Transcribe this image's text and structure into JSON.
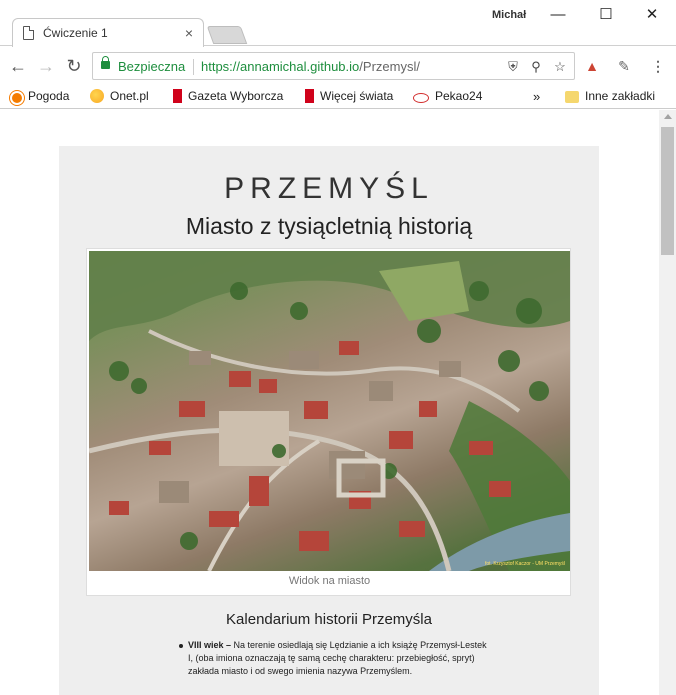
{
  "window": {
    "tab_title": "Ćwiczenie 1",
    "profile_name": "Michał",
    "minimize_icon": "minimize-icon",
    "maximize_icon": "maximize-icon",
    "close_icon": "close-icon"
  },
  "toolbar": {
    "secure_label": "Bezpieczna",
    "url_base": "https://annamichal.github.io",
    "url_path": "/Przemysl/"
  },
  "bookmarks": {
    "items": [
      {
        "label": "Pogoda",
        "icon": "sun-icon"
      },
      {
        "label": "Onet.pl",
        "icon": "onet-icon"
      },
      {
        "label": "Gazeta Wyborcza",
        "icon": "gw-icon"
      },
      {
        "label": "Więcej świata",
        "icon": "gw-icon"
      },
      {
        "label": "Pekao24",
        "icon": "pekao-icon"
      }
    ],
    "overflow": "»",
    "other_bookmarks": "Inne zakładki"
  },
  "page": {
    "title": "PRZEMYŚL",
    "subtitle": "Miasto z tysiącletnią historią",
    "photo_caption": "Widok na miasto",
    "photo_watermark": "fot. Krzysztof Kaczor - UM Przemyśl",
    "section_title": "Kalendarium historii Przemyśla",
    "timeline": [
      {
        "period": "VIII wiek –",
        "text": "Na terenie osiedlają się Lędzianie a ich książę Przemysł-Lestek I, (oba imiona oznaczają tę samą cechę charakteru: przebiegłość, spryt) zakłada miasto i od swego imienia nazywa Przemyślem."
      }
    ]
  }
}
